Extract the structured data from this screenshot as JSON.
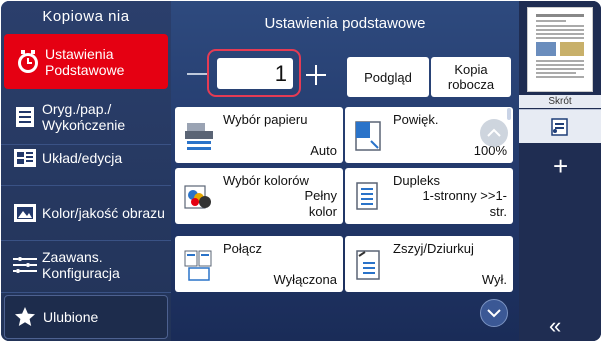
{
  "sidebar": {
    "title": "Kopiowa nia",
    "items": [
      {
        "label": "Ustawienia Podstawowe",
        "icon": "clock-settings-icon",
        "active": true
      },
      {
        "label": "Oryg./pap./ Wykończenie",
        "icon": "document-lines-icon",
        "active": false
      },
      {
        "label": "Układ/edycja",
        "icon": "layout-icon",
        "active": false
      },
      {
        "label": "Kolor/jakość obrazu",
        "icon": "image-icon",
        "active": false
      },
      {
        "label": "Zaawans. Konfiguracja",
        "icon": "advanced-config-icon",
        "active": false
      }
    ],
    "favorites_label": "Ulubione"
  },
  "main": {
    "title": "Ustawienia podstawowe",
    "copies_value": "1",
    "preview_label": "Podgląd",
    "draft_label": "Kopia robocza",
    "tiles": [
      {
        "title": "Wybór papieru",
        "value": "Auto",
        "icon": "paper-tray-icon"
      },
      {
        "title": "Powięk.",
        "value": "100%",
        "icon": "zoom-icon"
      },
      {
        "title": "Wybór kolorów",
        "value": "Pełny kolor",
        "icon": "color-select-icon"
      },
      {
        "title": "Dupleks",
        "value": "1-stronny >>1-str.",
        "icon": "duplex-icon"
      },
      {
        "title": "Połącz",
        "value": "Wyłączona",
        "icon": "combine-icon"
      },
      {
        "title": "Zszyj/Dziurkuj",
        "value": "Wył.",
        "icon": "staple-punch-icon"
      }
    ]
  },
  "right_panel": {
    "shortcut_label": "Skrót",
    "plus_glyph": "+",
    "collapse_glyph": "«"
  },
  "colors": {
    "accent_red": "#e50012",
    "highlight_border": "#e53b54",
    "background": "#22386a"
  }
}
